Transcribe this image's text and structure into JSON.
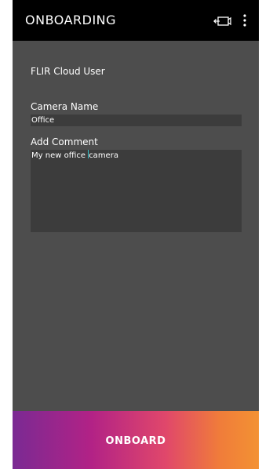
{
  "header": {
    "title": "ONBOARDING",
    "camera_icon": "camera-add-icon",
    "menu_icon": "more-vertical-icon"
  },
  "form": {
    "user_label": "FLIR Cloud User",
    "camera_name_label": "Camera Name",
    "camera_name_value": "Office",
    "comment_label": "Add Comment",
    "comment_before_cursor": "My new office ",
    "comment_after_cursor": "camera"
  },
  "footer": {
    "onboard_label": "ONBOARD"
  },
  "colors": {
    "appbar": "#000000",
    "background": "#4d4d4d",
    "field": "#3c3c3c",
    "caret": "#35c0c9",
    "gradient_start": "#7a2a93",
    "gradient_end": "#f39233"
  }
}
